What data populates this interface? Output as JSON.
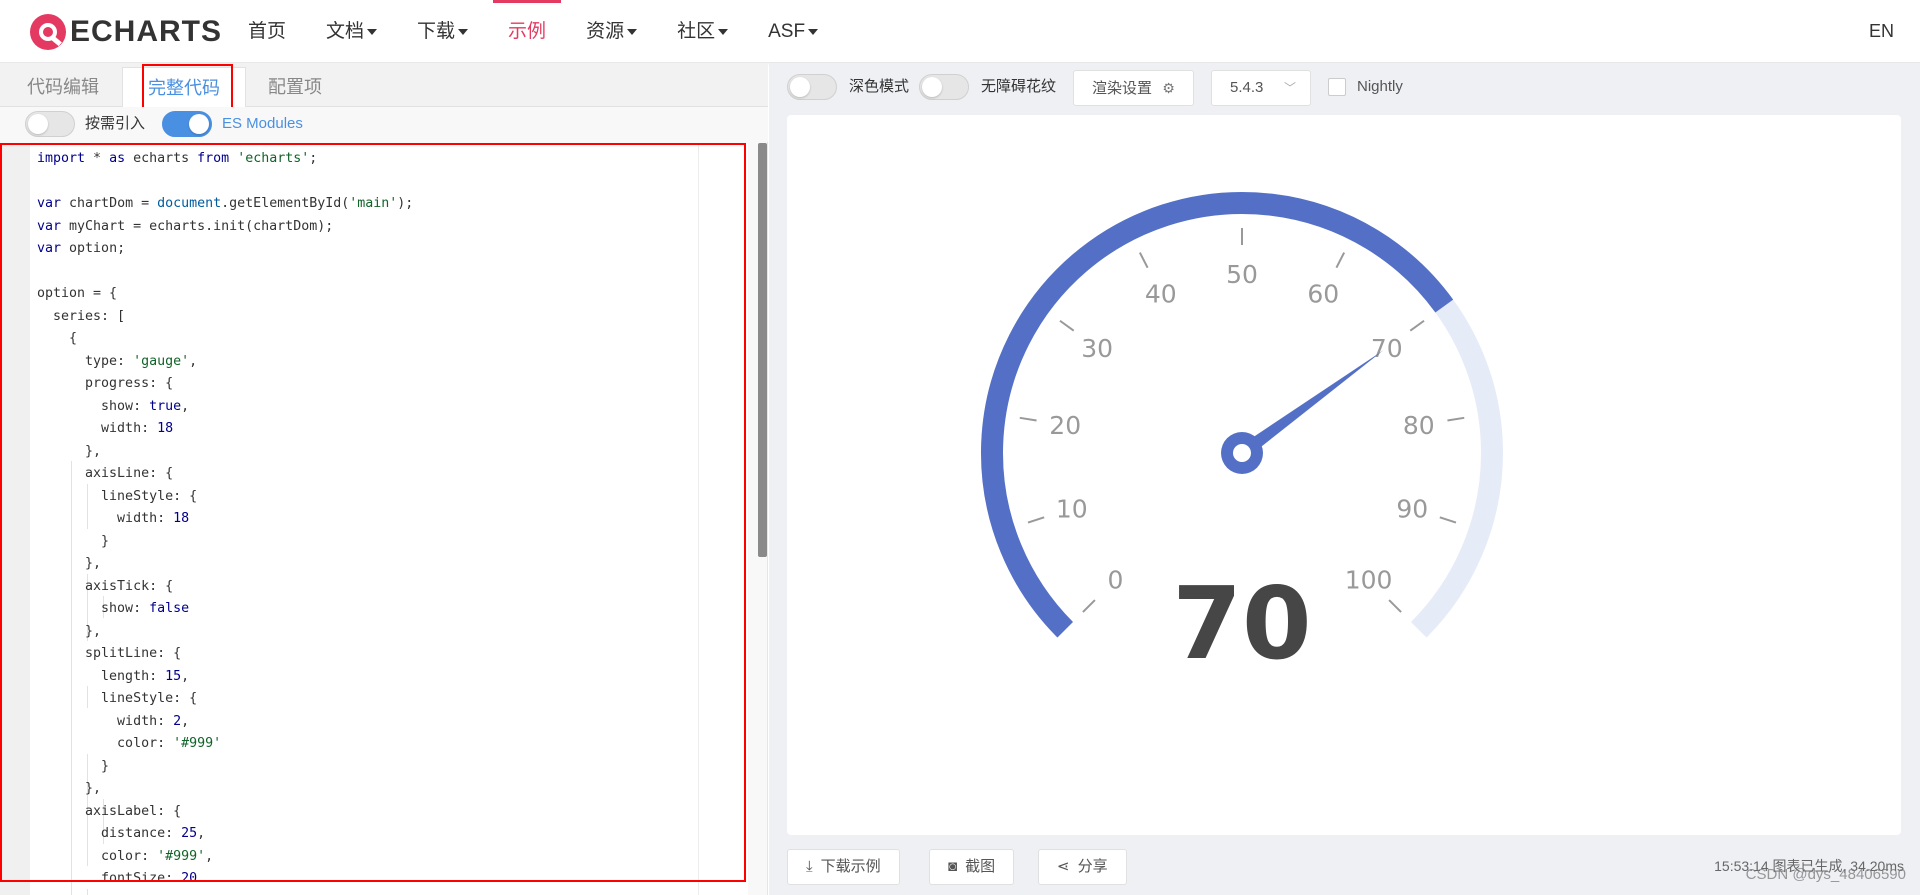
{
  "nav": {
    "logo_text": "ECHARTS",
    "items": [
      {
        "label": "首页",
        "caret": false,
        "active": false
      },
      {
        "label": "文档",
        "caret": true,
        "active": false
      },
      {
        "label": "下载",
        "caret": true,
        "active": false
      },
      {
        "label": "示例",
        "caret": false,
        "active": true
      },
      {
        "label": "资源",
        "caret": true,
        "active": false
      },
      {
        "label": "社区",
        "caret": true,
        "active": false
      },
      {
        "label": "ASF",
        "caret": true,
        "active": false
      }
    ],
    "lang": "EN"
  },
  "editor_tabs": {
    "code_edit": "代码编辑",
    "full_code": "完整代码",
    "config": "配置项"
  },
  "options": {
    "on_demand": "按需引入",
    "es_modules": "ES Modules"
  },
  "code_lines": [
    "import * as echarts from 'echarts';",
    "",
    "var chartDom = document.getElementById('main');",
    "var myChart = echarts.init(chartDom);",
    "var option;",
    "",
    "option = {",
    "  series: [",
    "    {",
    "      type: 'gauge',",
    "      progress: {",
    "        show: true,",
    "        width: 18",
    "      },",
    "      axisLine: {",
    "        lineStyle: {",
    "          width: 18",
    "        }",
    "      },",
    "      axisTick: {",
    "        show: false",
    "      },",
    "      splitLine: {",
    "        length: 15,",
    "        lineStyle: {",
    "          width: 2,",
    "          color: '#999'",
    "        }",
    "      },",
    "      axisLabel: {",
    "        distance: 25,",
    "        color: '#999',",
    "        fontSize: 20",
    "      },"
  ],
  "toolbar": {
    "dark_mode": "深色模式",
    "accessible": "无障碍花纹",
    "render_settings": "渲染设置",
    "version": "5.4.3",
    "nightly": "Nightly"
  },
  "bottom": {
    "download": "下载示例",
    "screenshot": "截图",
    "share": "分享",
    "status": "15:53:14  图表已生成, 34.20ms",
    "watermark": "CSDN @dys_48406590"
  },
  "colors": {
    "accent": "#e43961",
    "link_blue": "#4a90e2",
    "gauge_progress": "#5470c6",
    "gauge_track": "#e6ebf8"
  },
  "chart_data": {
    "type": "gauge",
    "value": 70,
    "min": 0,
    "max": 100,
    "tick_labels": [
      "0",
      "10",
      "20",
      "30",
      "40",
      "50",
      "60",
      "70",
      "80",
      "90",
      "100"
    ],
    "detail": "70"
  }
}
